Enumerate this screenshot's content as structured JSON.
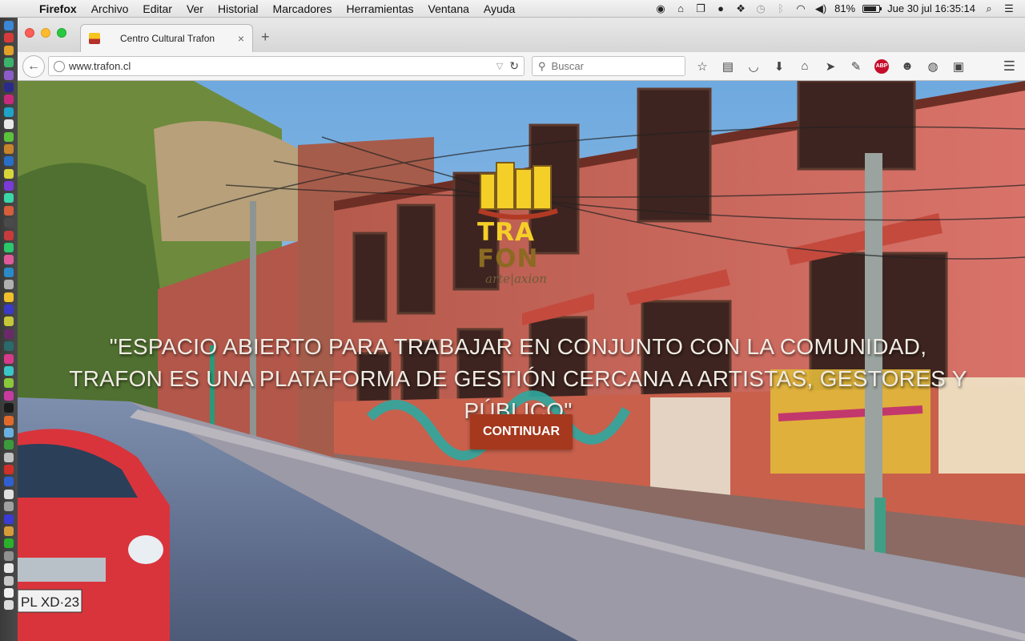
{
  "menubar": {
    "app_name": "Firefox",
    "items": [
      "Archivo",
      "Editar",
      "Ver",
      "Historial",
      "Marcadores",
      "Herramientas",
      "Ventana",
      "Ayuda"
    ],
    "battery": "81%",
    "battery_level": 0.81,
    "clock": "Jue 30 jul  16:35:14"
  },
  "tab": {
    "title": "Centro Cultural Trafon"
  },
  "navbar": {
    "url": "www.trafon.cl",
    "search_placeholder": "Buscar"
  },
  "page": {
    "logo_line1": "TRA",
    "logo_line2": "FON",
    "logo_sub": "arte|axion",
    "quote": "\"ESPACIO ABIERTO PARA TRABAJAR EN CONJUNTO CON LA COMUNIDAD, TRAFON ES UNA PLATAFORMA DE GESTIÓN CERCANA A ARTISTAS, GESTORES Y PÚBLICO\"",
    "continue_label": "CONTINUAR",
    "accent_color": "#a5381d"
  }
}
